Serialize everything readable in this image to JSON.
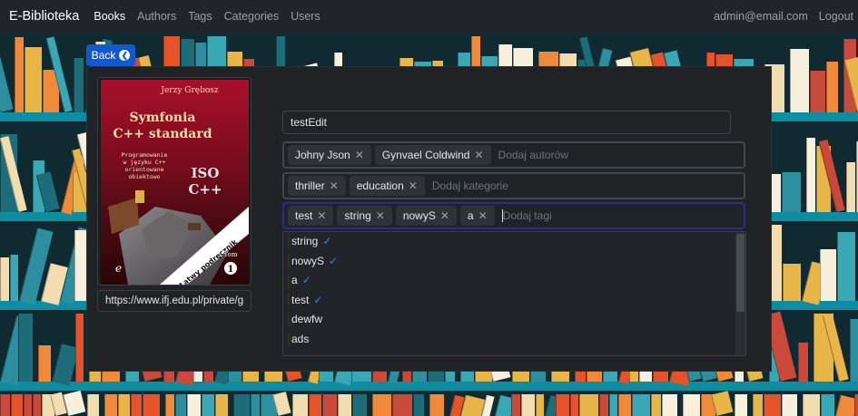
{
  "colors": {
    "navbar": "#212529",
    "accent": "#1059d0",
    "panel": "#202326",
    "check": "#3d7df5",
    "shelf": "#0c8ea0"
  },
  "navbar": {
    "brand": "E-Biblioteka",
    "links": [
      {
        "label": "Books",
        "active": true
      },
      {
        "label": "Authors"
      },
      {
        "label": "Tags"
      },
      {
        "label": "Categories"
      },
      {
        "label": "Users"
      }
    ],
    "user_email": "admin@email.com",
    "logout_label": "Logout"
  },
  "back_button": {
    "label": "Back",
    "icon": "chevron-left-icon"
  },
  "book": {
    "cover": {
      "author": "Jerzy Grębosz",
      "title_line1": "Symfonia",
      "title_line2": "C++ standard",
      "subtitle": "Programowanie\nw języku C++\norientowane\nobiektowo",
      "iso_line1": "ISO",
      "iso_line2": "C++",
      "ribbon": "Łatwy podręcznik",
      "volume_label": "Tom",
      "volume_number": "1",
      "publisher_mark": "e"
    },
    "image_url": "https://www.ifj.edu.pl/private/g",
    "title": "testEdit"
  },
  "authors": {
    "chips": [
      "Johny Json",
      "Gynvael Coldwind"
    ],
    "placeholder": "Dodaj autorów"
  },
  "categories": {
    "chips": [
      "thriller",
      "education"
    ],
    "placeholder": "Dodaj kategorie"
  },
  "tags": {
    "chips": [
      "test",
      "string",
      "nowyS",
      "a"
    ],
    "placeholder": "Dodaj tagi"
  },
  "tag_options": [
    {
      "label": "string",
      "selected": true
    },
    {
      "label": "nowyS",
      "selected": true
    },
    {
      "label": "a",
      "selected": true
    },
    {
      "label": "test",
      "selected": true
    },
    {
      "label": "dewfw",
      "selected": false
    },
    {
      "label": "ads",
      "selected": false
    }
  ]
}
